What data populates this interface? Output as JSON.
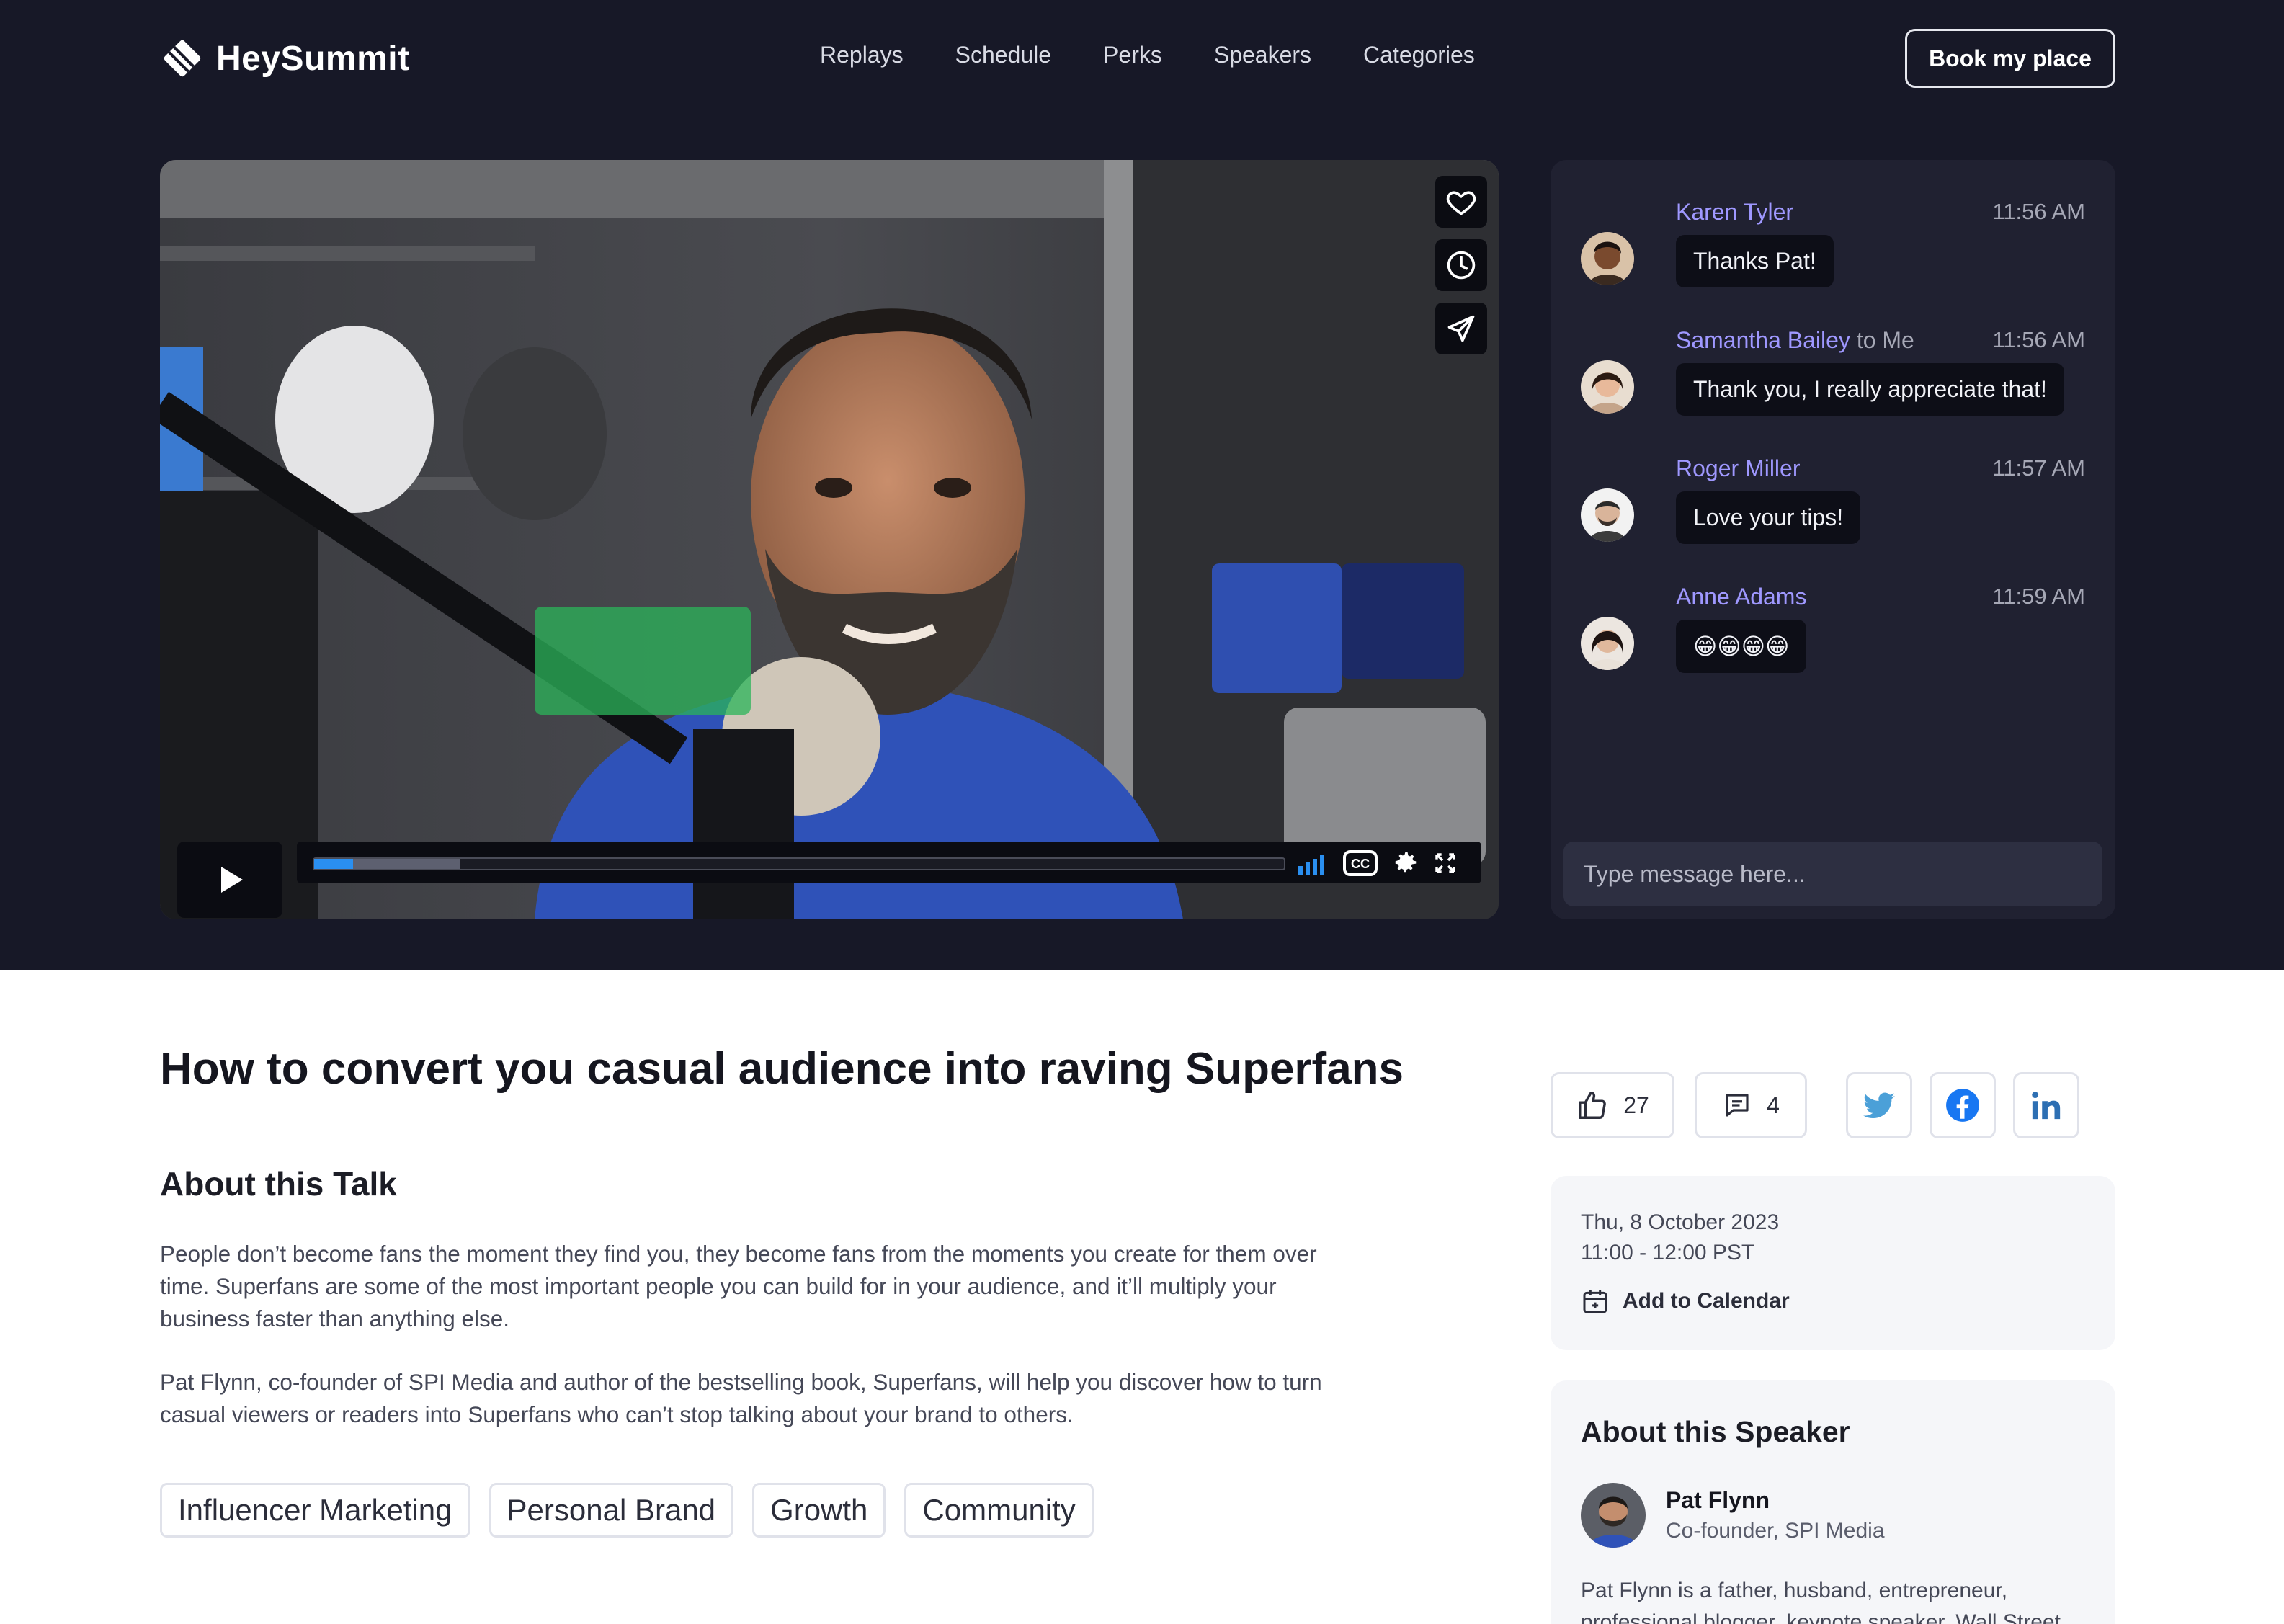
{
  "header": {
    "logo_text": "HeySummit",
    "nav": [
      "Replays",
      "Schedule",
      "Perks",
      "Speakers",
      "Categories"
    ],
    "cta_label": "Book my place"
  },
  "video": {
    "side_actions": [
      "heart-icon",
      "clock-icon",
      "send-icon"
    ],
    "progress_played": 0.04,
    "progress_buffered": 0.15,
    "control_icons": [
      "signal-bars-icon",
      "cc-icon",
      "gear-icon",
      "fullscreen-icon"
    ]
  },
  "chat": {
    "messages": [
      {
        "name": "Karen Tyler",
        "to": "",
        "time": "11:56 AM",
        "text": "Thanks Pat!"
      },
      {
        "name": "Samantha Bailey",
        "to": "to Me",
        "time": "11:56 AM",
        "text": "Thank you, I really appreciate that!"
      },
      {
        "name": "Roger Miller",
        "to": "",
        "time": "11:57 AM",
        "text": "Love your tips!"
      },
      {
        "name": "Anne Adams",
        "to": "",
        "time": "11:59 AM",
        "text": "😁😁😁😁"
      }
    ],
    "input_placeholder": "Type message here..."
  },
  "talk": {
    "title": "How to convert you casual audience into raving Superfans",
    "about_heading": "About this Talk",
    "paragraph_1": "People don’t become fans the moment they find you, they become fans from the moments you create for them over time. Superfans are some of the most important people you can build for in your audience, and it’ll multiply your business faster than anything else.",
    "paragraph_2": "Pat Flynn, co-founder of SPI Media and author of the bestselling book, Superfans, will help you discover how to turn casual viewers or readers into Superfans who can’t stop talking about your brand to others.",
    "tags": [
      "Influencer Marketing",
      "Personal Brand",
      "Growth",
      "Community"
    ]
  },
  "engagement": {
    "likes": "27",
    "comments": "4",
    "share": [
      "twitter-icon",
      "facebook-icon",
      "linkedin-icon"
    ]
  },
  "schedule": {
    "date": "Thu, 8 October 2023",
    "time": "11:00 - 12:00 PST",
    "add_to_calendar": "Add to Calendar"
  },
  "speaker": {
    "heading": "About this Speaker",
    "name": "Pat Flynn",
    "role": "Co-founder, SPI Media",
    "bio": "Pat Flynn is a father, husband, entrepreneur, professional blogger, keynote speaker, Wall Street"
  },
  "colors": {
    "hero_bg": "#171827",
    "chat_bg": "#202131",
    "chat_name": "#9f98ff",
    "progress": "#2a8ff0"
  }
}
